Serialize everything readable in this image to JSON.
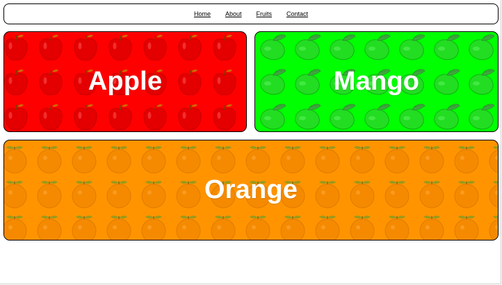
{
  "nav": {
    "links": [
      "Home",
      "About",
      "Fruits",
      "Contact"
    ]
  },
  "cards": {
    "apple": {
      "title": "Apple",
      "background": "#ff0000",
      "icon": "apple-icon"
    },
    "mango": {
      "title": "Mango",
      "background": "#00ff00",
      "icon": "mango-icon"
    },
    "orange": {
      "title": "Orange",
      "background": "#ff9400",
      "icon": "orange-icon"
    }
  }
}
